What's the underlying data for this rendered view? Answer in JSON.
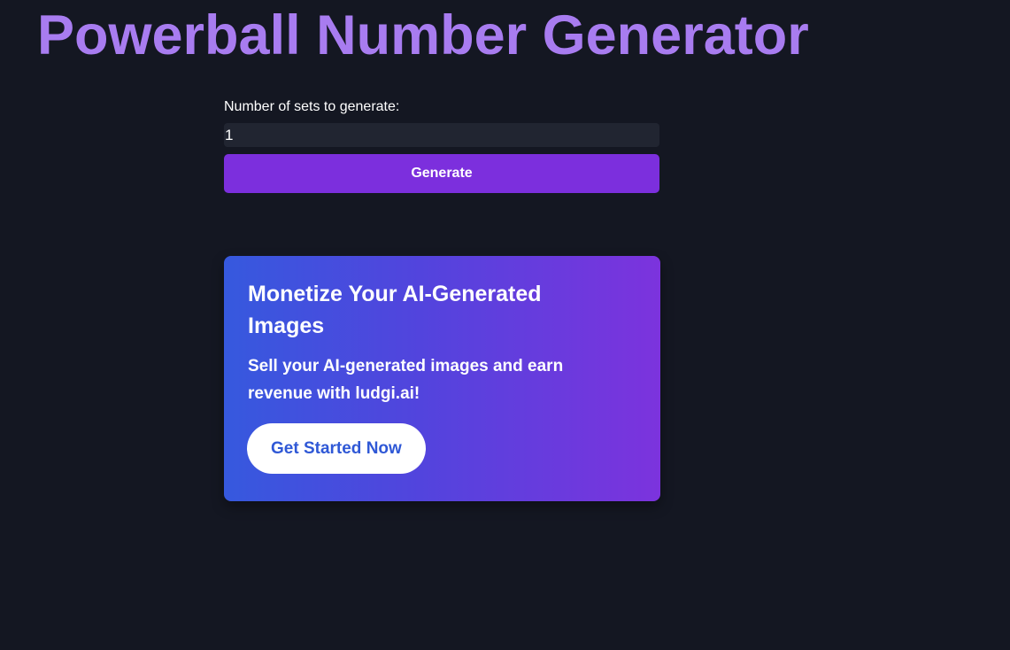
{
  "header": {
    "title": "Powerball Number Generator"
  },
  "form": {
    "sets_label": "Number of sets to generate:",
    "sets_value": "1",
    "generate_label": "Generate"
  },
  "promo": {
    "heading": "Monetize Your AI-Generated Images",
    "text": "Sell your AI-generated images and earn revenue with ludgi.ai!",
    "cta_label": "Get Started Now"
  },
  "colors": {
    "background": "#141722",
    "title": "#a87cf0",
    "generate_button": "#7c2fdd",
    "promo_gradient_start": "#3659de",
    "promo_gradient_end": "#7c33dd",
    "cta_text": "#2f58d6"
  }
}
